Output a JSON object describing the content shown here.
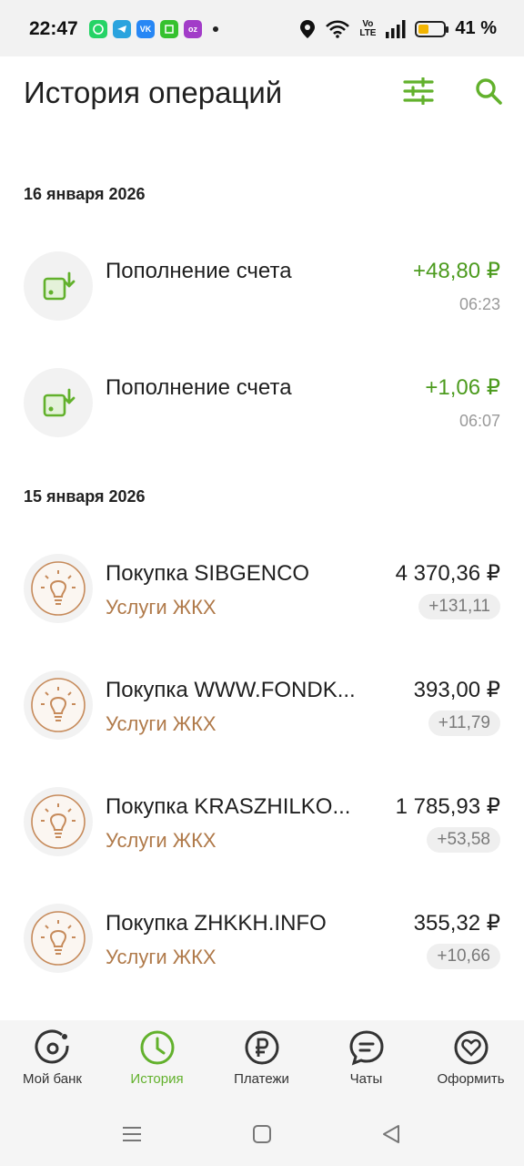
{
  "status_bar": {
    "time": "22:47",
    "apps": [
      {
        "name": "whatsapp-icon",
        "color": "#25d366"
      },
      {
        "name": "telegram-icon",
        "color": "#2aa3de"
      },
      {
        "name": "vk-icon",
        "color": "#2787f5"
      },
      {
        "name": "app-green-icon",
        "color": "#35c12e"
      },
      {
        "name": "ozon-icon",
        "color": "#a23cc8"
      }
    ],
    "volte": "Vo LTE",
    "battery_percent": 41,
    "battery_text": "41 %"
  },
  "header": {
    "title": "История операций",
    "accent_color": "#62b12c"
  },
  "groups": [
    {
      "date": "16 января 2026",
      "items": [
        {
          "title": "Пополнение счета",
          "amount": "+48,80 ₽",
          "time": "06:23",
          "icon": "wallet-deposit-icon"
        },
        {
          "title": "Пополнение счета",
          "amount": "+1,06 ₽",
          "time": "06:07",
          "icon": "wallet-deposit-icon"
        }
      ]
    },
    {
      "date": "15 января 2026",
      "items": [
        {
          "title": "Покупка SIBGENCO",
          "category": "Услуги ЖКХ",
          "amount": "4 370,36 ₽",
          "cashback": "+131,11",
          "icon": "lightbulb-icon"
        },
        {
          "title": "Покупка WWW.FONDK...",
          "category": "Услуги ЖКХ",
          "amount": "393,00 ₽",
          "cashback": "+11,79",
          "icon": "lightbulb-icon"
        },
        {
          "title": "Покупка KRASZHILKO...",
          "category": "Услуги ЖКХ",
          "amount": "1 785,93 ₽",
          "cashback": "+53,58",
          "icon": "lightbulb-icon"
        },
        {
          "title": "Покупка ZHKKH.INFO",
          "category": "Услуги ЖКХ",
          "amount": "355,32 ₽",
          "cashback": "+10,66",
          "icon": "lightbulb-icon"
        }
      ]
    }
  ],
  "bottom_nav": {
    "items": [
      {
        "label": "Мой банк",
        "icon": "my-bank-icon",
        "active": false
      },
      {
        "label": "История",
        "icon": "clock-icon",
        "active": true
      },
      {
        "label": "Платежи",
        "icon": "ruble-icon",
        "active": false
      },
      {
        "label": "Чаты",
        "icon": "chat-icon",
        "active": false
      },
      {
        "label": "Оформить",
        "icon": "heart-icon",
        "active": false
      }
    ]
  }
}
